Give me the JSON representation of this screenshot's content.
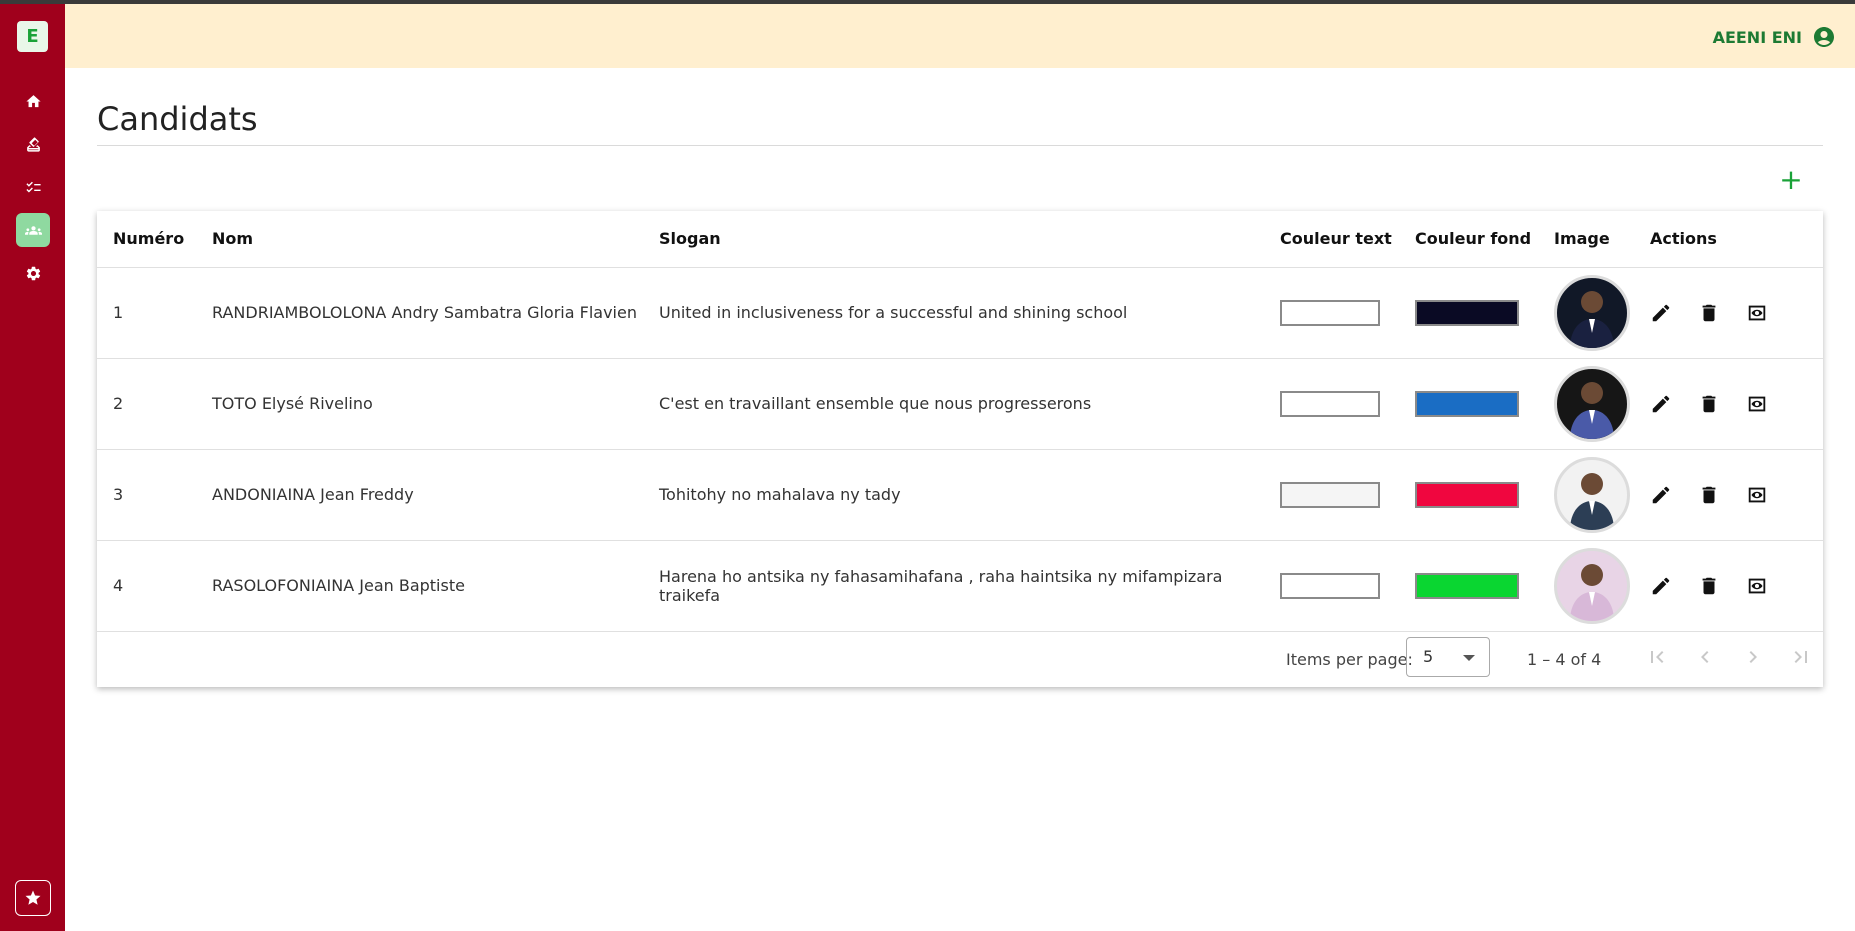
{
  "app": {
    "logo_letter": "E",
    "user_name": "AEENI ENI"
  },
  "sidebar": {
    "items": [
      {
        "icon": "home-icon"
      },
      {
        "icon": "ballot-box-icon"
      },
      {
        "icon": "checklist-icon"
      },
      {
        "icon": "group-icon",
        "active": true
      },
      {
        "icon": "gear-icon"
      }
    ],
    "bottom_icon": "star-icon"
  },
  "page": {
    "title": "Candidats",
    "add_label": "+"
  },
  "table": {
    "headers": [
      "Numéro",
      "Nom",
      "Slogan",
      "Couleur text",
      "Couleur fond",
      "Image",
      "Actions"
    ],
    "rows": [
      {
        "num": "1",
        "name": "RANDRIAMBOLOLONA Andry Sambatra Gloria Flavien",
        "slogan": "United in inclusiveness for a successful and shining school",
        "text_color": "#ffffff",
        "bg_color": "#0a0a24",
        "avatar_bg": "#111827",
        "avatar_suit": "#1a2140"
      },
      {
        "num": "2",
        "name": "TOTO Elysé Rivelino",
        "slogan": "C'est en travaillant ensemble que nous progresserons",
        "text_color": "#ffffff",
        "bg_color": "#1a6dc4",
        "avatar_bg": "#161616",
        "avatar_suit": "#4a5aa8"
      },
      {
        "num": "3",
        "name": "ANDONIAINA Jean Freddy",
        "slogan": "Tohitohy no mahalava ny tady",
        "text_color": "#f5f5f5",
        "bg_color": "#f0063f",
        "avatar_bg": "#f2f2f2",
        "avatar_suit": "#2c3e55"
      },
      {
        "num": "4",
        "name": "RASOLOFONIAINA Jean Baptiste",
        "slogan": "Harena ho antsika ny fahasamihafana , raha haintsika ny mifampizara traikefa",
        "text_color": "#ffffff",
        "bg_color": "#0ad631",
        "avatar_bg": "#e8d4e6",
        "avatar_suit": "#d8b8d8"
      }
    ]
  },
  "paginator": {
    "label": "Items per page:",
    "page_size": "5",
    "range": "1 – 4 of 4"
  }
}
